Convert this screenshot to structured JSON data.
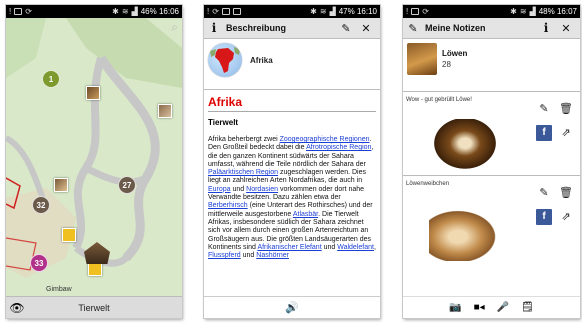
{
  "phone1": {
    "status": {
      "left_icons": [
        "alert-icon",
        "image-icon",
        "sync-icon"
      ],
      "right_text": "46% 16:06"
    },
    "markers": [
      {
        "label": "1",
        "color": "#7d9a2e"
      },
      {
        "label": "27",
        "color": "#6b5a4a"
      },
      {
        "label": "32",
        "color": "#6b5a4a"
      },
      {
        "label": "33",
        "color": "#b0308a"
      }
    ],
    "map_label": "Gimbaw",
    "bottom_title": "Tierwelt",
    "colors": {
      "map_bg": "#d8e8c8",
      "path": "#c7c7c7"
    }
  },
  "phone2": {
    "status": {
      "right_text": "47% 16:10"
    },
    "appbar_title": "Beschreibung",
    "globe_label": "Afrika",
    "heading": "Afrika",
    "subheading": "Tierwelt",
    "paragraph": [
      {
        "t": "Afrika beherbergt zwei "
      },
      {
        "t": "Zoogeographische Regionen",
        "link": true
      },
      {
        "t": ". Den Großteil bedeckt dabei die "
      },
      {
        "t": "Afrotropische Region",
        "link": true
      },
      {
        "t": ", die den ganzen Kontinent südwärts der Sahara umfasst, während die Teile nördlich der Sahara der "
      },
      {
        "t": "Paläarktischen Region",
        "link": true
      },
      {
        "t": " zugeschlagen werden. Dies liegt an zahlreichen Arten Nordafrikas, die auch in "
      },
      {
        "t": "Europa",
        "link": true
      },
      {
        "t": " und "
      },
      {
        "t": "Nordasien",
        "link": true
      },
      {
        "t": " vorkommen oder dort nahe Verwandte besitzen. Dazu zählen etwa der "
      },
      {
        "t": "Berberhirsch",
        "link": true
      },
      {
        "t": " (eine Unterart des Rothirsches) und der mittlerweile ausgestorbene "
      },
      {
        "t": "Atlasbär",
        "link": true
      },
      {
        "t": ". Die Tierwelt Afrikas, insbesondere südlich der Sahara zeichnet sich vor allem durch einen großen Artenreichtum an Großsäugern aus. Die größten Landsäugerarten des Kontinents sind "
      },
      {
        "t": "Afrikanischer Elefant",
        "link": true
      },
      {
        "t": " und "
      },
      {
        "t": "Waldelefant",
        "link": true
      },
      {
        "t": ", "
      },
      {
        "t": "Flusspferd",
        "link": true
      },
      {
        "t": " und "
      },
      {
        "t": "Nashörner",
        "link": true
      }
    ],
    "colors": {
      "heading": "#e00000",
      "link": "#1a3fd6"
    }
  },
  "phone3": {
    "status": {
      "right_text": "48% 16:07"
    },
    "appbar_title": "Meine Notizen",
    "animal_name": "Löwen",
    "animal_number": "28",
    "notes": [
      {
        "caption": "Wow - gut gebrüllt  Löwe!"
      },
      {
        "caption": "Löwenweibchen"
      }
    ],
    "bottom_icons": [
      "camera-icon",
      "video-icon",
      "microphone-icon",
      "note-icon"
    ],
    "colors": {
      "facebook": "#3b5998"
    }
  }
}
